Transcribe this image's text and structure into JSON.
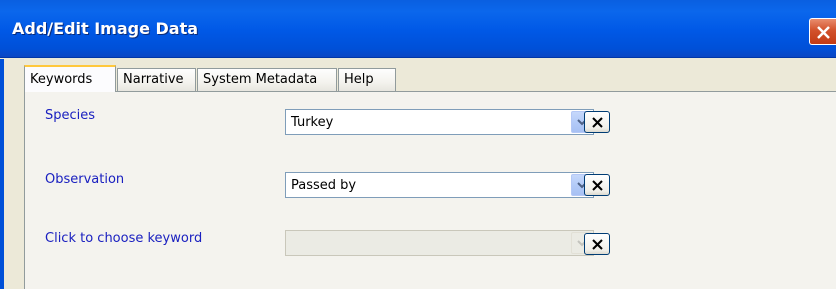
{
  "window": {
    "title": "Add/Edit Image Data",
    "close_icon": "close-icon"
  },
  "tabs": [
    {
      "label": "Keywords",
      "active": true
    },
    {
      "label": "Narrative",
      "active": false
    },
    {
      "label": "System Metadata",
      "active": false
    },
    {
      "label": "Help",
      "active": false
    }
  ],
  "keywords": {
    "species": {
      "label": "Species",
      "value": "Turkey"
    },
    "observation": {
      "label": "Observation",
      "value": "Passed by"
    },
    "choose": {
      "label": "Click to choose keyword",
      "value": "",
      "disabled": true
    }
  },
  "colors": {
    "titlebar": "#0058e6",
    "label_blue": "#1a20c0",
    "close_red": "#d2522c",
    "active_tab_highlight": "#ffc83c"
  }
}
